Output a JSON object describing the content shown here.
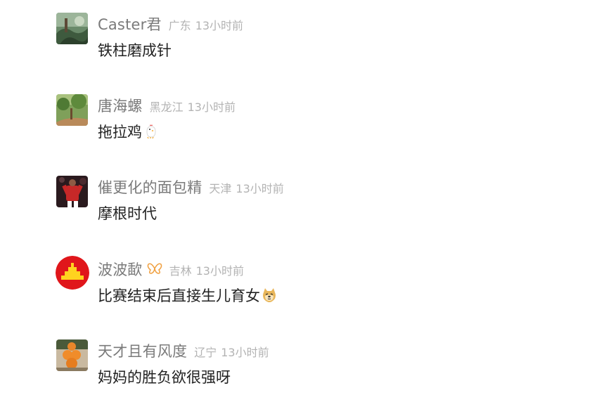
{
  "comments": [
    {
      "username": "Caster君",
      "location": "广东",
      "time": "13小时前",
      "text": "铁柱磨成针",
      "avatar_icon": "nature-photo-avatar"
    },
    {
      "username": "唐海螺",
      "location": "黑龙江",
      "time": "13小时前",
      "text": "拖拉鸡",
      "avatar_icon": "garden-photo-avatar",
      "emoji": "chicken-emoji"
    },
    {
      "username": "催更化的面包精",
      "location": "天津",
      "time": "13小时前",
      "text": "摩根时代",
      "avatar_icon": "football-player-avatar"
    },
    {
      "username": "波波歃",
      "location": "吉林",
      "time": "13小时前",
      "text": "比赛结束后直接生儿育女",
      "avatar_icon": "red-yellow-logo-avatar",
      "badge_icon": "butterfly-badge-icon",
      "emoji": "doge-emoji"
    },
    {
      "username": "天才且有风度",
      "location": "辽宁",
      "time": "13小时前",
      "text": "妈妈的胜负欲很强呀",
      "avatar_icon": "orange-figure-avatar"
    }
  ],
  "colors": {
    "username": "#7a7a7a",
    "meta": "#b3b3b3",
    "text": "#222222",
    "badge": "#f0a040"
  }
}
